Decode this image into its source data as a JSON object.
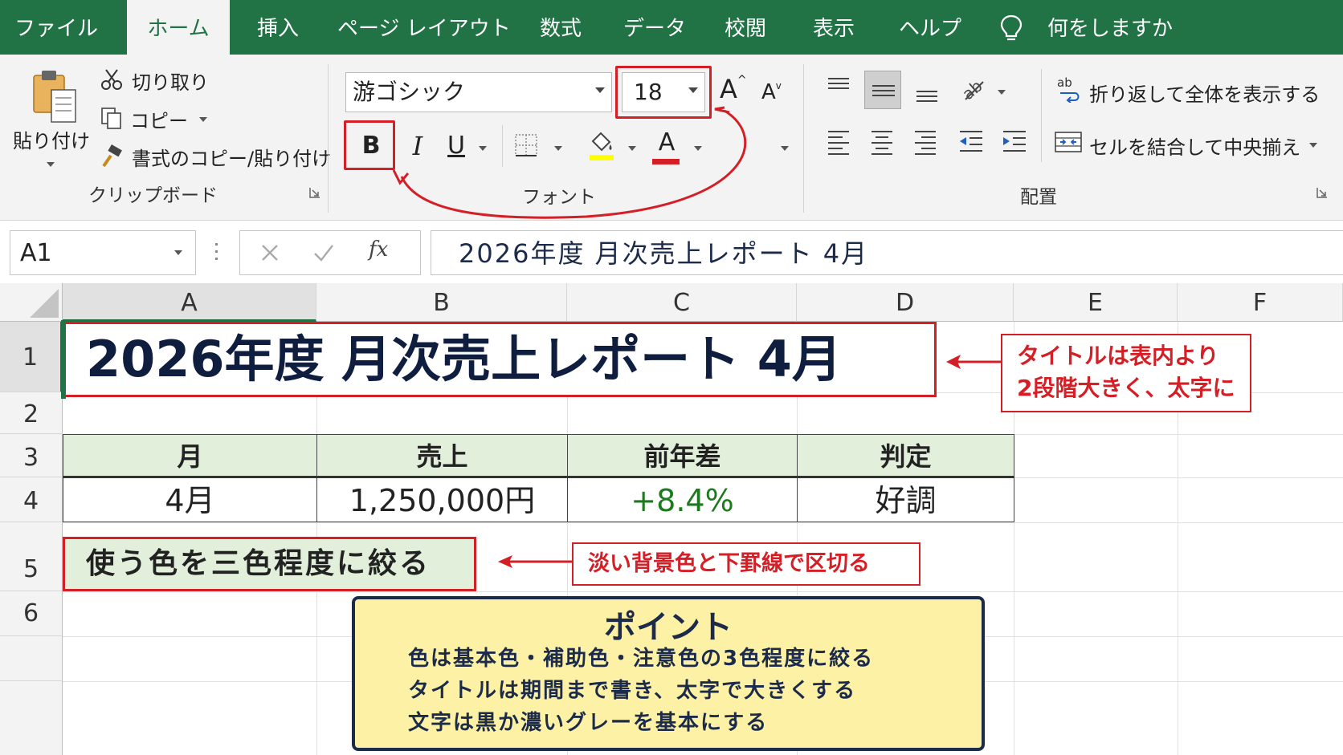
{
  "tabs": [
    {
      "label": "ファイル"
    },
    {
      "label": "ホーム",
      "active": true
    },
    {
      "label": "挿入"
    },
    {
      "label": "ページ レイアウト"
    },
    {
      "label": "数式"
    },
    {
      "label": "データ"
    },
    {
      "label": "校閲"
    },
    {
      "label": "表示"
    },
    {
      "label": "ヘルプ"
    }
  ],
  "tell_me": "何をしますか",
  "clipboard": {
    "paste": "貼り付け",
    "cut": "切り取り",
    "copy": "コピー",
    "format_painter": "書式のコピー/貼り付け",
    "group": "クリップボード"
  },
  "font": {
    "name": "游ゴシック",
    "size": "18",
    "bold": "B",
    "italic": "I",
    "underline": "U",
    "font_color_glyph": "A",
    "group": "フォント",
    "highlight_color": "#ffff00",
    "font_color": "#d41f26"
  },
  "alignment": {
    "wrap": "折り返して全体を表示する",
    "merge": "セルを結合して中央揃え",
    "group": "配置"
  },
  "formula_bar": {
    "name_box": "A1",
    "fx": "fx",
    "content": "2026年度 月次売上レポート 4月"
  },
  "columns": [
    "A",
    "B",
    "C",
    "D",
    "E",
    "F"
  ],
  "rows": [
    "1",
    "2",
    "3",
    "4",
    "5",
    "6"
  ],
  "sheet": {
    "title": "2026年度 月次売上レポート 4月",
    "headers": [
      "月",
      "売上",
      "前年差",
      "判定"
    ],
    "values": [
      "4月",
      "1,250,000円",
      "+8.4%",
      "好調"
    ],
    "a5": "使う色を三色程度に絞る",
    "header_fill": "#e2efda",
    "positive_color": "#1e7a1e"
  },
  "annotations": {
    "title_note": [
      "タイトルは表内より",
      "2段階大きく、太字に"
    ],
    "header_note": "淡い背景色と下罫線で区切る",
    "accent_color": "#d41f26"
  },
  "point": {
    "heading": "ポイント",
    "lines": [
      "色は基本色・補助色・注意色の3色程度に絞る",
      "タイトルは期間まで書き、太字で大きくする",
      "文字は黒か濃いグレーを基本にする"
    ]
  }
}
